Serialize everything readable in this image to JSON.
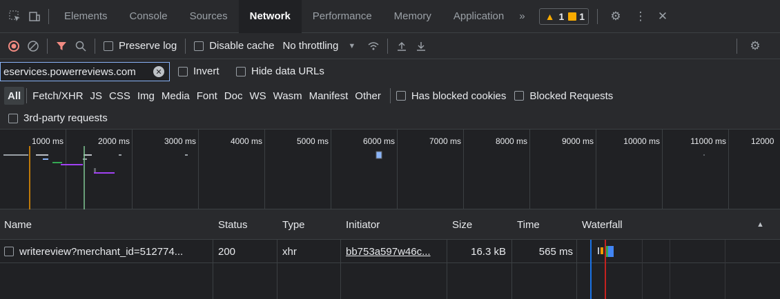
{
  "toolbar": {
    "tabs": [
      {
        "label": "Elements"
      },
      {
        "label": "Console"
      },
      {
        "label": "Sources"
      },
      {
        "label": "Network"
      },
      {
        "label": "Performance"
      },
      {
        "label": "Memory"
      },
      {
        "label": "Application"
      }
    ],
    "more_tabs": "»",
    "warnings_count": "1",
    "issues_count": "1"
  },
  "network_toolbar": {
    "preserve_log": "Preserve log",
    "disable_cache": "Disable cache",
    "throttling": "No throttling"
  },
  "filter": {
    "value": "eservices.powerreviews.com",
    "invert": "Invert",
    "hide_data_urls": "Hide data URLs"
  },
  "type_filters": [
    {
      "label": "All",
      "active": true
    },
    {
      "label": "Fetch/XHR"
    },
    {
      "label": "JS"
    },
    {
      "label": "CSS"
    },
    {
      "label": "Img"
    },
    {
      "label": "Media"
    },
    {
      "label": "Font"
    },
    {
      "label": "Doc"
    },
    {
      "label": "WS"
    },
    {
      "label": "Wasm"
    },
    {
      "label": "Manifest"
    },
    {
      "label": "Other"
    }
  ],
  "extra_filters": {
    "has_blocked_cookies": "Has blocked cookies",
    "blocked_requests": "Blocked Requests",
    "third_party": "3rd-party requests"
  },
  "timeline": {
    "ticks": [
      "1000 ms",
      "2000 ms",
      "3000 ms",
      "4000 ms",
      "5000 ms",
      "6000 ms",
      "7000 ms",
      "8000 ms",
      "9000 ms",
      "10000 ms",
      "11000 ms",
      "12000"
    ]
  },
  "table": {
    "headers": {
      "name": "Name",
      "status": "Status",
      "type": "Type",
      "initiator": "Initiator",
      "size": "Size",
      "time": "Time",
      "waterfall": "Waterfall"
    },
    "rows": [
      {
        "name": "writereview?merchant_id=512774...",
        "status": "200",
        "type": "xhr",
        "initiator": "bb753a597w46c...",
        "size": "16.3 kB",
        "time": "565 ms"
      }
    ]
  },
  "colors": {
    "accent": "#8ab4f8",
    "warning": "#f9ab00",
    "record_red": "#f28b82"
  }
}
